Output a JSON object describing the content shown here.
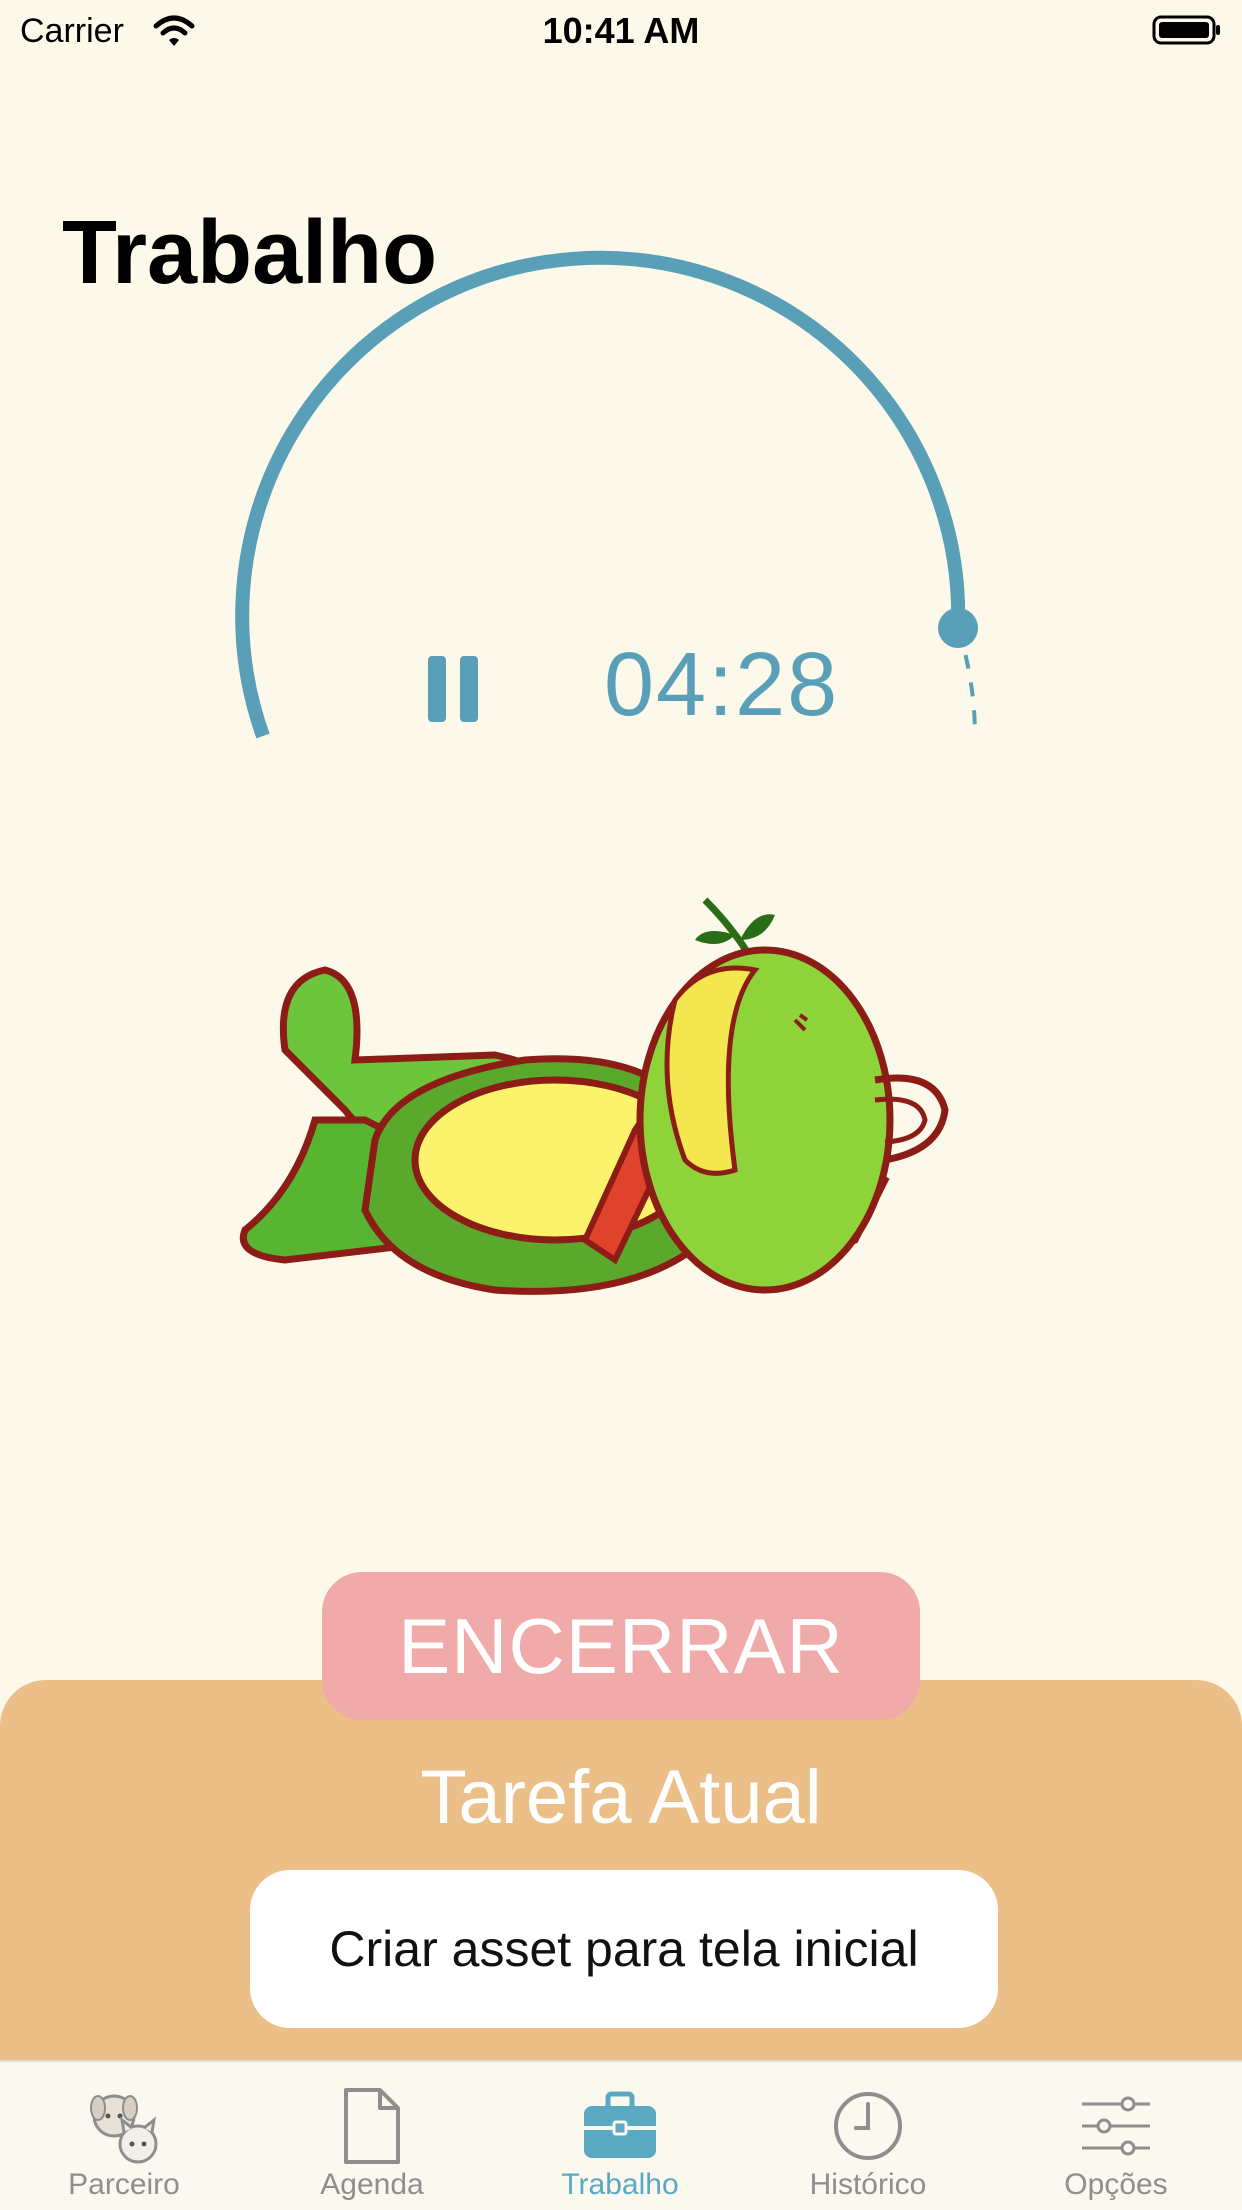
{
  "status_bar": {
    "carrier": "Carrier",
    "time": "10:41 AM"
  },
  "page": {
    "title": "Trabalho"
  },
  "timer": {
    "value": "04:28",
    "progress": 0.75,
    "accent_color": "#5a9fb8"
  },
  "actions": {
    "end_label": "ENCERRAR"
  },
  "task": {
    "section_label": "Tarefa Atual",
    "current_value": "Criar asset para tela inicial"
  },
  "tab_bar": {
    "active_color": "#5aa8c2",
    "tabs": [
      {
        "label": "Parceiro",
        "icon": "pets-icon"
      },
      {
        "label": "Agenda",
        "icon": "document-icon"
      },
      {
        "label": "Trabalho",
        "icon": "briefcase-icon"
      },
      {
        "label": "Histórico",
        "icon": "clock-icon"
      },
      {
        "label": "Opções",
        "icon": "sliders-icon"
      }
    ],
    "selected_tab": "Trabalho"
  },
  "colors": {
    "background": "#fcf9ea",
    "end_button": "#f1aaaa",
    "panel": "#ebbf87"
  }
}
